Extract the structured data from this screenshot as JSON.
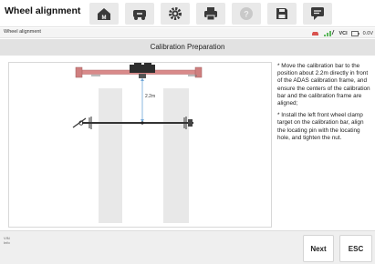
{
  "app": {
    "title": "Wheel alignment"
  },
  "toolbar": {
    "buttons": [
      {
        "icon": "home-icon",
        "label": "M"
      },
      {
        "icon": "vehicle-swap-icon"
      },
      {
        "icon": "settings-gear-icon"
      },
      {
        "icon": "print-icon"
      },
      {
        "icon": "help-icon"
      },
      {
        "icon": "save-icon"
      },
      {
        "icon": "message-icon"
      }
    ]
  },
  "breadcrumb": {
    "text": "Wheel alignment"
  },
  "status": {
    "vci_label": "VCI",
    "battery_text": "0.0V"
  },
  "page": {
    "title": "Calibration Preparation"
  },
  "diagram": {
    "distance_label": "2.2m",
    "colors": {
      "frame": "#d98a8a",
      "bar": "#333333",
      "guide": "#6fa6d8",
      "rail": "#e8e8e8"
    }
  },
  "instructions": {
    "step1": "* Move the calibration bar to the position about 2.2m directly in front of the ADAS calibration frame, and ensure the centers of the calibration bar and the calibration frame are aligned;",
    "step2": "* Install the left front wheel clamp target on the calibration bar, align the locating pin with the locating hole, and tighten the nut."
  },
  "footer": {
    "vin_label": "VIN",
    "info_label": "Info",
    "next_label": "Next",
    "esc_label": "ESC"
  }
}
